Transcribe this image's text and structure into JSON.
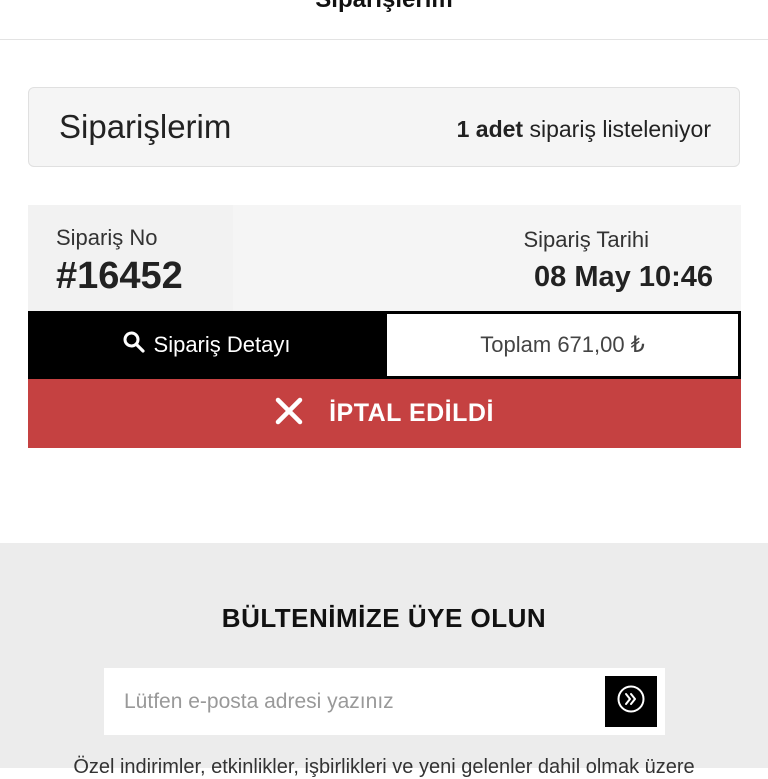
{
  "header": {
    "title": "Siparişlerim"
  },
  "summary": {
    "title": "Siparişlerim",
    "count": "1",
    "count_unit": "adet",
    "count_suffix": "sipariş listeleniyor"
  },
  "order": {
    "no_label": "Sipariş No",
    "no_value": "#16452",
    "date_label": "Sipariş Tarihi",
    "date_value": "08 May 10:46",
    "detail_button": "Sipariş Detayı",
    "total": "Toplam 671,00 ₺",
    "status": "İPTAL EDİLDİ",
    "status_color": "#c54141"
  },
  "newsletter": {
    "title": "BÜLTENİMİZE ÜYE OLUN",
    "email_placeholder": "Lütfen e-posta adresi yazınız",
    "info": "Özel indirimler, etkinlikler, işbirlikleri ve yeni gelenler dahil olmak üzere"
  },
  "icons": {
    "search": "search-icon",
    "close": "close-icon",
    "submit": "double-chevron-right-icon"
  }
}
